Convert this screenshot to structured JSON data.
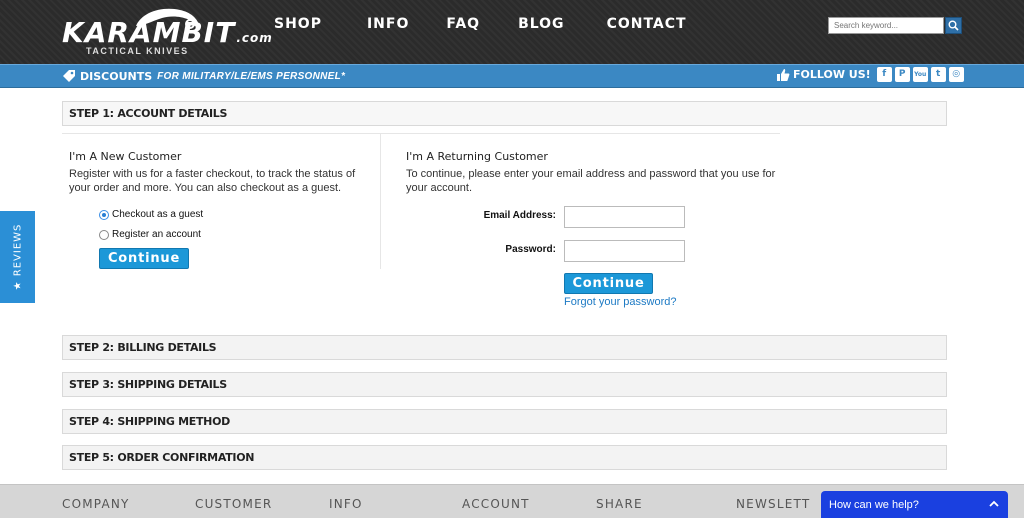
{
  "header": {
    "logo_text": "KARAMBIT",
    "logo_com": ".com",
    "logo_tagline": "TACTICAL KNIVES",
    "nav": [
      "SHOP",
      "INFO",
      "FAQ",
      "BLOG",
      "CONTACT"
    ],
    "search_placeholder": "Search keyword..."
  },
  "promo": {
    "title": "DISCOUNTS",
    "subtitle": "FOR MILITARY/LE/EMS PERSONNEL*",
    "follow_label": "FOLLOW US!",
    "social": [
      {
        "icon": "facebook-icon",
        "glyph": "f"
      },
      {
        "icon": "pinterest-icon",
        "glyph": "P"
      },
      {
        "icon": "youtube-icon",
        "glyph": "You"
      },
      {
        "icon": "tumblr-icon",
        "glyph": "t"
      },
      {
        "icon": "instagram-icon",
        "glyph": "◎"
      }
    ]
  },
  "reviews_tab": "★ REVIEWS",
  "steps": {
    "step1": "STEP 1: ACCOUNT DETAILS",
    "step2": "STEP 2: BILLING DETAILS",
    "step3": "STEP 3: SHIPPING DETAILS",
    "step4": "STEP 4: SHIPPING METHOD",
    "step5": "STEP 5: ORDER CONFIRMATION"
  },
  "new_customer": {
    "title": "I'm A New Customer",
    "text": "Register with us for a faster checkout, to track the status of your order and more. You can also checkout as a guest.",
    "option_guest": "Checkout as a guest",
    "option_register": "Register an account",
    "selected": "guest",
    "button": "Continue"
  },
  "returning_customer": {
    "title": "I'm A Returning Customer",
    "text": "To continue, please enter your email address and password that you use for your account.",
    "email_label": "Email Address:",
    "password_label": "Password:",
    "email_value": "",
    "password_value": "",
    "button": "Continue",
    "forgot": "Forgot your password?"
  },
  "footer": {
    "columns": [
      "COMPANY",
      "CUSTOMER",
      "INFO",
      "ACCOUNT",
      "SHARE",
      "NEWSLETT"
    ]
  },
  "chat": {
    "label": "How can we help?"
  },
  "colors": {
    "header_bg": "#2b2b2b",
    "promo_bar": "#3b88c3",
    "button": "#1c98d8",
    "link": "#1d7ac4",
    "chat": "#1a40e0"
  }
}
